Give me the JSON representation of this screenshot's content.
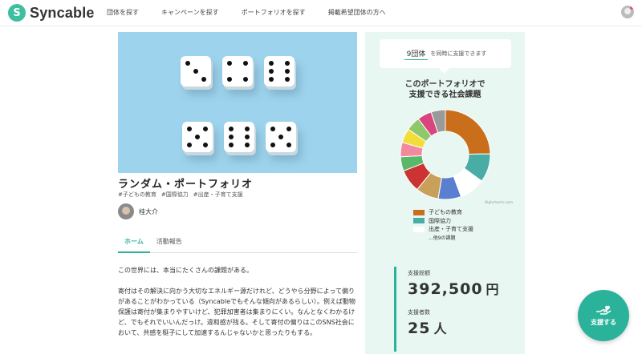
{
  "header": {
    "logo_letter": "S",
    "logo_text": "Syncable",
    "nav": [
      "団体を探す",
      "キャンペーンを探す",
      "ポートフォリオを探す",
      "掲載希望団体の方へ"
    ]
  },
  "portfolio": {
    "title": "ランダム・ポートフォリオ",
    "tags": [
      "#子どもの教育",
      "#国際協力",
      "#出産・子育て支援"
    ],
    "author": "桂大介",
    "tabs": [
      "ホーム",
      "活動報告"
    ],
    "body": [
      "この世界には、本当にたくさんの課題がある。",
      "寄付はその解決に向かう大切なエネルギー源だけれど、どうやら分野によって偏りがあることがわかっている（Syncableでもそんな傾向があるらしい）。例えば動物保護は寄付が集まりやすいけど、犯罪加害者は集まりにくい。なんとなくわかるけど、でもそれでいいんだっけ。違和感が残る。そして寄付の偏りはこのSNS社会において、共感を梃子にして加速するんじゃないかと思ったりもする。"
    ]
  },
  "panel": {
    "count_value": "9団体",
    "count_suffix": "を同時に支援できます",
    "heading_line1": "このポートフォリオで",
    "heading_line2": "支援できる社会課題",
    "credit": "Highcharts.com",
    "legend": [
      {
        "label": "子どもの教育",
        "color": "#c96f1c"
      },
      {
        "label": "国際協力",
        "color": "#4aada5"
      },
      {
        "label": "出産・子育て支援",
        "color": "#ffffff"
      }
    ],
    "legend_more": "...他9の課題",
    "total_label": "支援総額",
    "total_value": "392,500",
    "total_unit": "円",
    "supporters_label": "支援者数",
    "supporters_value": "25",
    "supporters_unit": "人"
  },
  "fab_label": "支援する",
  "chart_data": {
    "type": "pie",
    "categories": [
      "子どもの教育",
      "国際協力",
      "出産・子育て支援",
      "",
      "",
      "",
      "",
      "",
      "",
      "",
      "",
      ""
    ],
    "values": [
      24,
      10,
      9,
      8,
      8,
      8,
      5,
      5,
      5,
      5,
      5,
      5
    ],
    "colors": [
      "#c96f1c",
      "#4aada5",
      "#ffffff",
      "#5a7ed0",
      "#c9a05a",
      "#cc3333",
      "#5ab86a",
      "#f28a9e",
      "#f2de3a",
      "#8fc86a",
      "#d9457f",
      "#9a9a9a"
    ]
  }
}
